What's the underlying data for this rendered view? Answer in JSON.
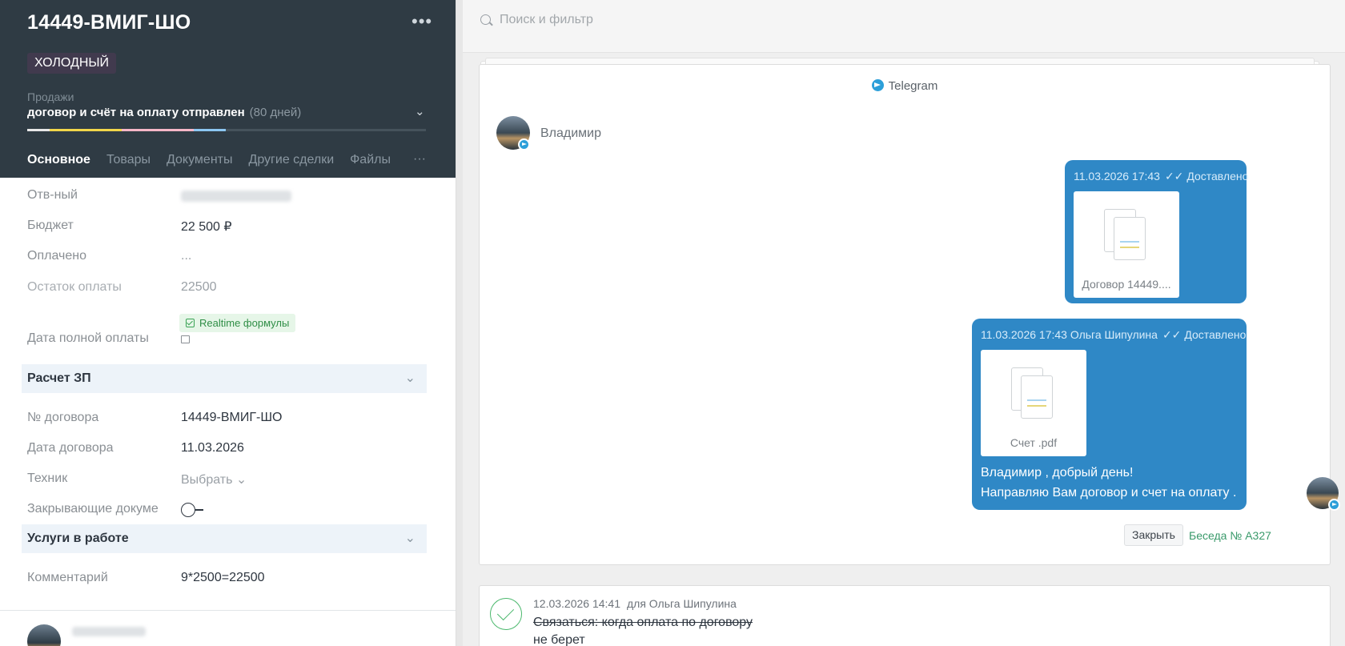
{
  "lead": {
    "title": "14449-ВМИГ-ШО",
    "tag": "ХОЛОДНЫЙ",
    "pipeline": "Продажи",
    "stage": "договор и счёт на оплату отправлен",
    "stage_days": "(80 дней)",
    "progress_colors": [
      "#e8e8e8",
      "#f1d64a",
      "#f4b6c7",
      "#8cc6f2"
    ]
  },
  "tabs": [
    "Основное",
    "Товары",
    "Документы",
    "Другие сделки",
    "Файлы"
  ],
  "fields": {
    "responsible": {
      "label": "Отв-ный"
    },
    "budget": {
      "label": "Бюджет",
      "value": "22 500 ₽"
    },
    "paid": {
      "label": "Оплачено",
      "value": "..."
    },
    "remaining": {
      "label": "Остаток оплаты",
      "value": "22500"
    },
    "realtime_badge": "Realtime формулы",
    "full_payment_date": {
      "label": "Дата полной оплаты"
    },
    "section_salary": "Расчет ЗП",
    "contract_no": {
      "label": "№ договора",
      "value": "14449-ВМИГ-ШО"
    },
    "contract_date": {
      "label": "Дата договора",
      "value": "11.03.2026"
    },
    "technician": {
      "label": "Техник",
      "value": "Выбрать"
    },
    "closing_docs": {
      "label": "Закрывающие докуме"
    },
    "section_services": "Услуги в работе",
    "comment": {
      "label": "Комментарий",
      "value": "9*2500=22500"
    }
  },
  "search": {
    "placeholder": "Поиск и фильтр"
  },
  "chat": {
    "channel": "Telegram",
    "contact_name": "Владимир",
    "messages": [
      {
        "meta": "11.03.2026 17:43",
        "status": "Доставлено",
        "file": "Договор 14449...."
      },
      {
        "meta": "11.03.2026 17:43 Ольга Шипулина",
        "status": "Доставлено",
        "file": "Счет .pdf",
        "text_line1": "Владимир , добрый день!",
        "text_line2": "Направляю Вам договор и счет на оплату ."
      }
    ],
    "close_button": "Закрыть",
    "conversation_link": "Беседа № А327"
  },
  "task": {
    "datetime": "12.03.2026 14:41",
    "for": "для Ольга Шипулина",
    "text_line1": "Связаться: когда оплата по договору",
    "text_line2": "не берет"
  },
  "icons": {
    "menu": "more-dots-icon",
    "telegram": "telegram-icon",
    "search": "search-icon",
    "check": "task-complete-icon"
  }
}
